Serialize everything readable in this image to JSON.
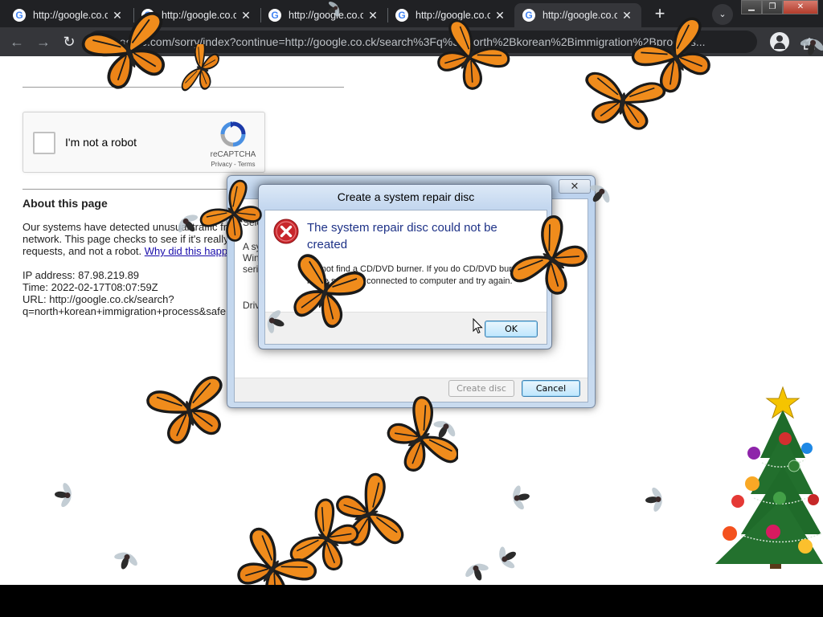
{
  "browser": {
    "tabs": [
      {
        "title": "http://google.co.ck",
        "active": false
      },
      {
        "title": "http://google.co.ck",
        "active": false
      },
      {
        "title": "http://google.co.ck",
        "active": false
      },
      {
        "title": "http://google.co.ck",
        "active": false
      },
      {
        "title": "http://google.co.ck",
        "active": true
      }
    ],
    "tab_favicon_letter": "G",
    "tab_close_glyph": "✕",
    "new_tab_glyph": "+",
    "tab_search_glyph": "⌄",
    "window_controls": {
      "minimize": "▁",
      "maximize": "❐",
      "close": "✕"
    },
    "nav": {
      "back": "←",
      "forward": "→",
      "reload": "↻"
    },
    "url": "google.com/sorry/index?continue=http://google.co.ck/search%3Fq%3Dnorth%2Bkorean%2Bimmigration%2Bprocess...",
    "bookmark_glyph": "☆",
    "icons": [
      "lock-icon",
      "share-icon",
      "star-icon",
      "profile-icon"
    ]
  },
  "page": {
    "recaptcha": {
      "checkbox_label": "I'm not a robot",
      "brand": "reCAPTCHA",
      "terms": "Privacy - Terms"
    },
    "about": {
      "heading": "About this page",
      "line1": "Our systems have detected unusual traffic fr",
      "line2": "network. This page checks to see if it's really",
      "line3_text": "requests, and not a robot. ",
      "line3_link": "Why did this happ",
      "ip": "IP address: 87.98.219.89",
      "time": "Time: 2022-02-17T08:07:59Z",
      "url1": "URL: http://google.co.ck/search?",
      "url2": "q=north+korean+immigration+process&safe"
    }
  },
  "dialog_background": {
    "close_glyph": "✕",
    "fragments": [
      "Sele",
      "A sy",
      "Win",
      "seri",
      "Driv"
    ],
    "create_button": "Create disc",
    "cancel_button": "Cancel"
  },
  "dialog_error": {
    "title": "Create a system repair disc",
    "heading": "The system repair disc could not be created",
    "body": "did not find a CD/DVD burner. If you do CD/DVD burner, make sure it is connected to computer and try again.",
    "ok_button": "OK"
  },
  "colors": {
    "chrome_dark": "#202124",
    "chrome_mid": "#35363a",
    "dialog_heading": "#1e3287",
    "error_red": "#c8262b",
    "link": "#1a0dab"
  }
}
